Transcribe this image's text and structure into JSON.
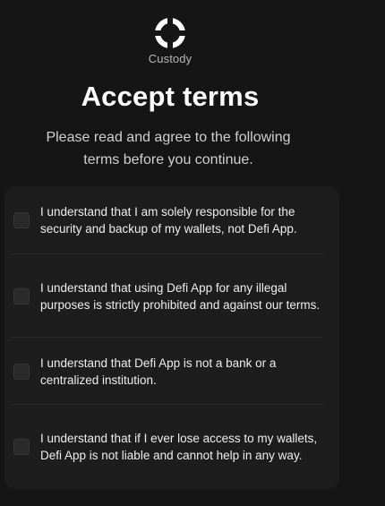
{
  "app": {
    "logo_label": "Custody"
  },
  "page": {
    "title": "Accept terms",
    "subtitle": "Please read and agree to the following terms before you continue."
  },
  "terms": [
    {
      "text": "I understand that I am solely responsible for the security and backup of my wallets, not Defi App.",
      "checked": false
    },
    {
      "text": "I understand that using Defi App for any illegal purposes is strictly prohibited and against our terms.",
      "checked": false
    },
    {
      "text": "I understand that Defi App is not a bank or a centralized institution.",
      "checked": false
    },
    {
      "text": "I understand that if I ever lose access to my wallets, Defi App is not liable and cannot help in any way.",
      "checked": false
    }
  ],
  "colors": {
    "background": "#151515",
    "card": "#1d1d1d",
    "text": "#ffffff",
    "muted": "#b7b7b7"
  }
}
